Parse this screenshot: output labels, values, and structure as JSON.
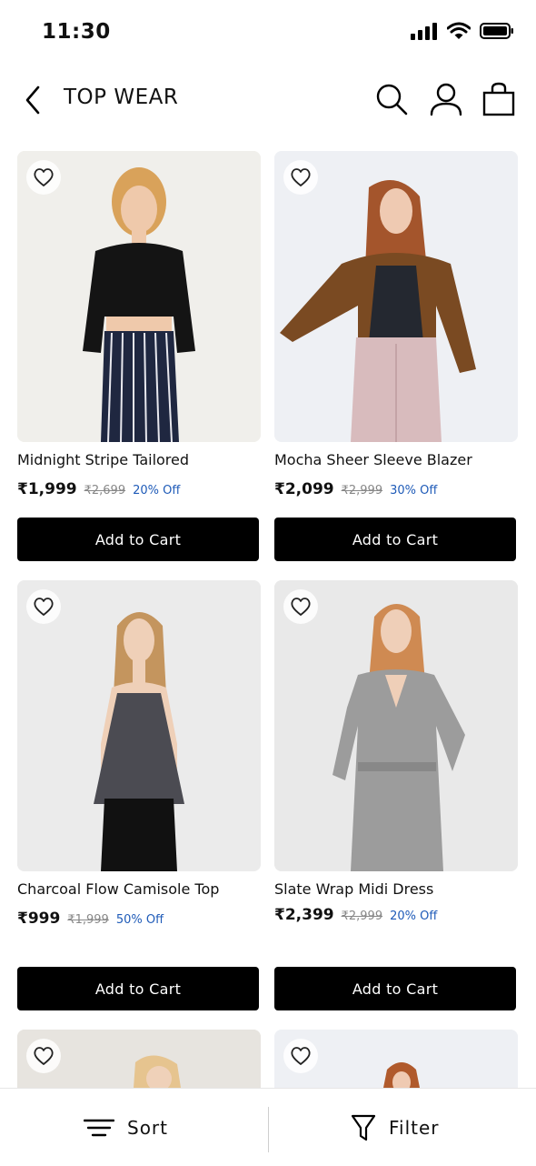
{
  "status": {
    "time": "11:30"
  },
  "header": {
    "title": "TOP WEAR"
  },
  "products": [
    {
      "name": "Midnight Stripe Tailored",
      "price": "₹1,999",
      "mrp": "₹2,699",
      "discount": "20% Off",
      "cta": "Add to Cart"
    },
    {
      "name": "Mocha Sheer Sleeve Blazer",
      "price": "₹2,099",
      "mrp": "₹2,999",
      "discount": "30% Off",
      "cta": "Add to Cart"
    },
    {
      "name": "Charcoal Flow Camisole Top",
      "price": "₹999",
      "mrp": "₹1,999",
      "discount": "50% Off",
      "cta": "Add to Cart"
    },
    {
      "name": "Slate Wrap Midi Dress",
      "price": "₹2,399",
      "mrp": "₹2,999",
      "discount": "20% Off",
      "cta": "Add to Cart"
    }
  ],
  "bottom_bar": {
    "sort_label": "Sort",
    "filter_label": "Filter"
  },
  "colors": {
    "accent": "#000000",
    "discount": "#1f5bb8"
  },
  "icons": [
    "back-arrow-icon",
    "search-icon",
    "user-icon",
    "bag-icon",
    "heart-icon",
    "sort-icon",
    "filter-icon"
  ]
}
